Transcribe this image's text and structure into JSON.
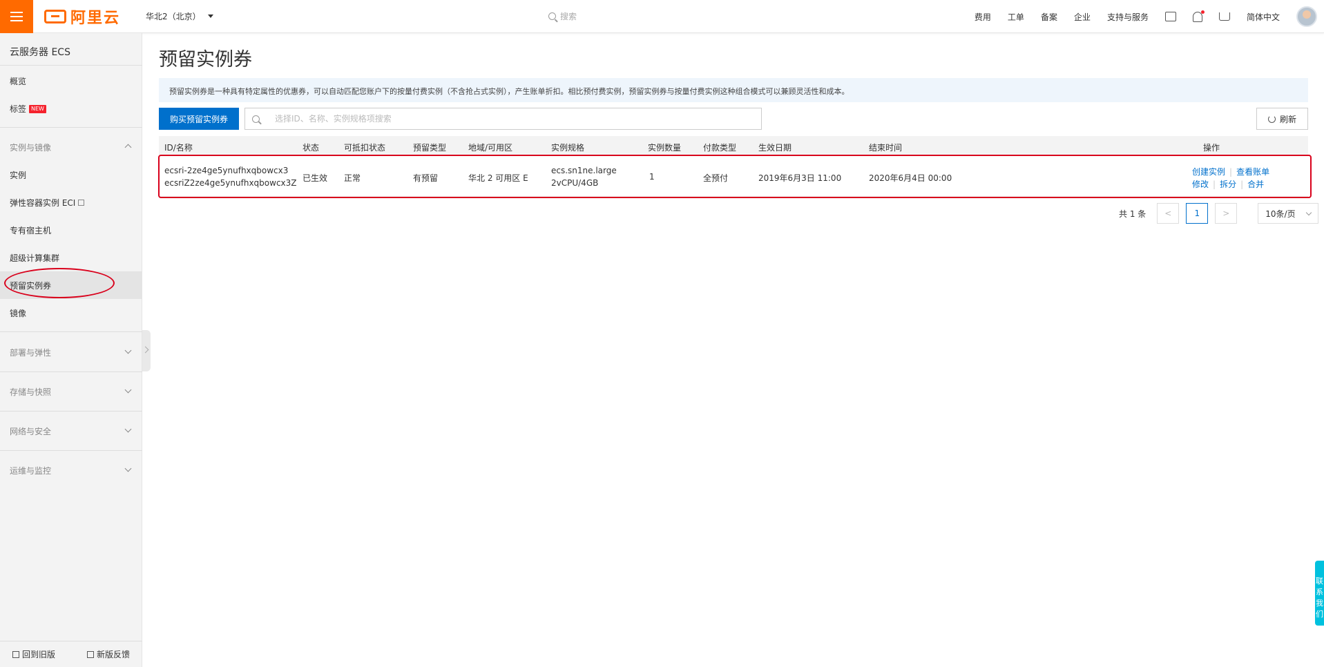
{
  "header": {
    "logo_text": "阿里云",
    "region": "华北2（北京）",
    "search_placeholder": "搜索",
    "nav": [
      "费用",
      "工单",
      "备案",
      "企业",
      "支持与服务"
    ],
    "language": "简体中文"
  },
  "sidebar": {
    "title": "云服务器 ECS",
    "overview": "概览",
    "tags": "标签",
    "new_badge": "NEW",
    "group_instances": "实例与镜像",
    "items": [
      "实例",
      "弹性容器实例 ECI",
      "专有宿主机",
      "超级计算集群",
      "预留实例券",
      "镜像"
    ],
    "group_deploy": "部署与弹性",
    "group_storage": "存储与快照",
    "group_network": "网络与安全",
    "group_ops": "运维与监控",
    "footer_back": "回到旧版",
    "footer_feedback": "新版反馈"
  },
  "main": {
    "title": "预留实例券",
    "notice": "预留实例券是一种具有特定属性的优惠券，可以自动匹配您账户下的按量付费实例（不含抢占式实例），产生账单折扣。相比预付费实例，预留实例券与按量付费实例这种组合模式可以兼顾灵活性和成本。",
    "buy_button": "购买预留实例券",
    "search_placeholder": "选择ID、名称、实例规格项搜索",
    "refresh_button": "刷新"
  },
  "table": {
    "headers": [
      "ID/名称",
      "状态",
      "可抵扣状态",
      "预留类型",
      "地域/可用区",
      "实例规格",
      "实例数量",
      "付款类型",
      "生效日期",
      "结束时间",
      "操作"
    ],
    "rows": [
      {
        "id": "ecsri-2ze4ge5ynufhxqbowcx3",
        "name": "ecsriZ2ze4ge5ynufhxqbowcx3Z",
        "status": "已生效",
        "deduct_status": "正常",
        "reserve_type": "有预留",
        "zone": "华北 2 可用区 E",
        "spec_line1": "ecs.sn1ne.large",
        "spec_line2": "2vCPU/4GB",
        "count": "1",
        "pay_type": "全预付",
        "start": "2019年6月3日 11:00",
        "end": "2020年6月4日 00:00",
        "actions": {
          "create": "创建实例",
          "bill": "查看账单",
          "modify": "修改",
          "split": "拆分",
          "merge": "合并"
        }
      }
    ]
  },
  "pagination": {
    "total": "共 1 条",
    "current_page": "1",
    "page_size": "10条/页"
  },
  "contact": "联系我们",
  "colors": {
    "brand": "#ff6a00",
    "primary": "#0070cc",
    "highlight": "#d9001b",
    "contact": "#00c1de"
  }
}
